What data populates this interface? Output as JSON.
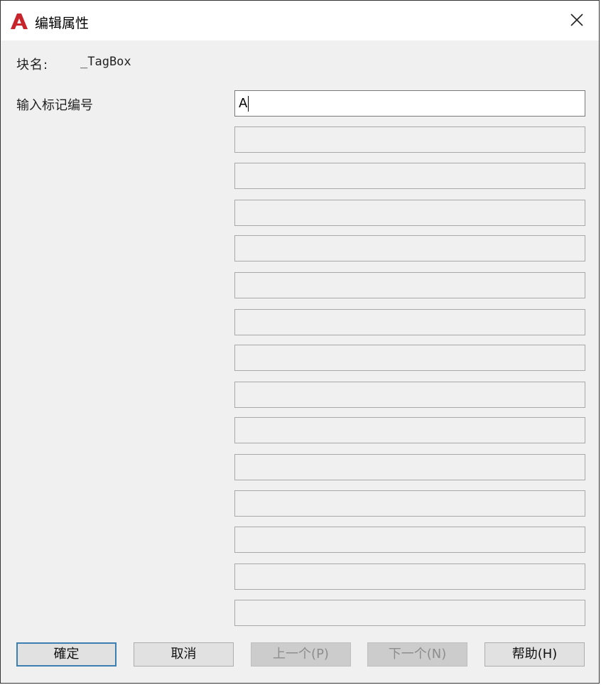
{
  "window": {
    "title": "编辑属性",
    "app_icon": "autocad-icon",
    "close_icon": "close-icon"
  },
  "block": {
    "label": "块名:",
    "value": "_TagBox"
  },
  "attribute": {
    "label": "输入标记编号",
    "value": "A"
  },
  "buttons": {
    "ok": "確定",
    "cancel": "取消",
    "prev": "上一个(P)",
    "next": "下一个(N)",
    "help": "帮助(H)"
  },
  "colors": {
    "app_icon_red": "#c8242c",
    "default_button_border": "#3c7fb1"
  }
}
